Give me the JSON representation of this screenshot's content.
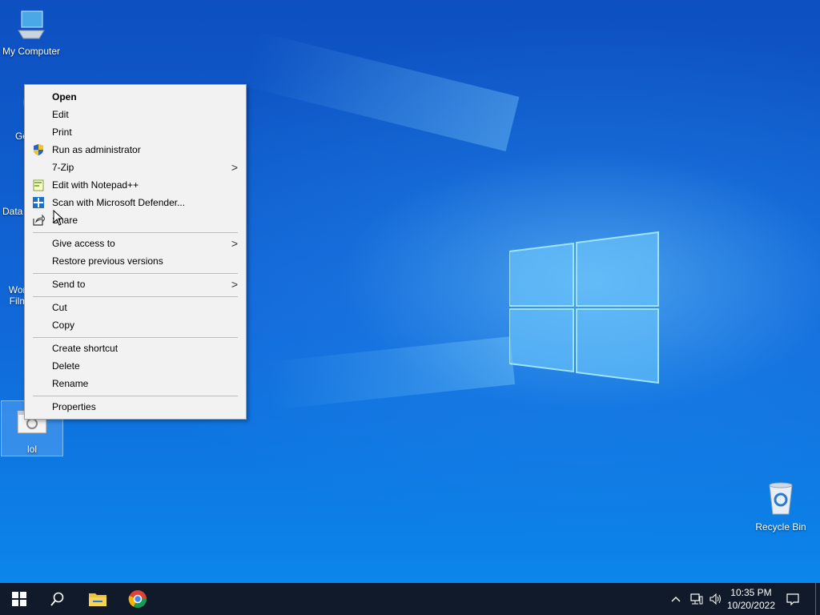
{
  "desktop": {
    "icons": [
      {
        "label": "My Computer"
      },
      {
        "label": "Go Ch"
      },
      {
        "label": "Data"
      },
      {
        "label": "Won Film"
      },
      {
        "label": "lol"
      },
      {
        "label": "Recycle Bin"
      }
    ]
  },
  "context_menu": {
    "items": [
      {
        "label": "Open",
        "bold": true
      },
      {
        "label": "Edit"
      },
      {
        "label": "Print"
      },
      {
        "label": "Run as administrator",
        "icon": "shield-icon"
      },
      {
        "label": "7-Zip",
        "submenu": true
      },
      {
        "label": "Edit with Notepad++",
        "icon": "notepad-plus-plus-icon"
      },
      {
        "label": "Scan with Microsoft Defender...",
        "icon": "defender-icon"
      },
      {
        "label": "Share",
        "icon": "share-icon"
      },
      {
        "label": "Give access to",
        "submenu": true
      },
      {
        "label": "Restore previous versions"
      },
      {
        "label": "Send to",
        "submenu": true
      },
      {
        "label": "Cut"
      },
      {
        "label": "Copy"
      },
      {
        "label": "Create shortcut"
      },
      {
        "label": "Delete"
      },
      {
        "label": "Rename"
      },
      {
        "label": "Properties"
      }
    ],
    "submenu_glyph": ">"
  },
  "taskbar": {
    "time": "10:35 PM",
    "date": "10/20/2022",
    "pinned": [
      "start-icon",
      "search-icon",
      "file-explorer-icon",
      "chrome-icon"
    ],
    "tray": [
      "chevron-up-icon",
      "network-icon",
      "volume-icon",
      "notification-icon"
    ]
  },
  "colors": {
    "taskbar": "#101a2a",
    "menu_bg": "#f2f2f2",
    "desktop_blue": "#0a5fd0"
  }
}
